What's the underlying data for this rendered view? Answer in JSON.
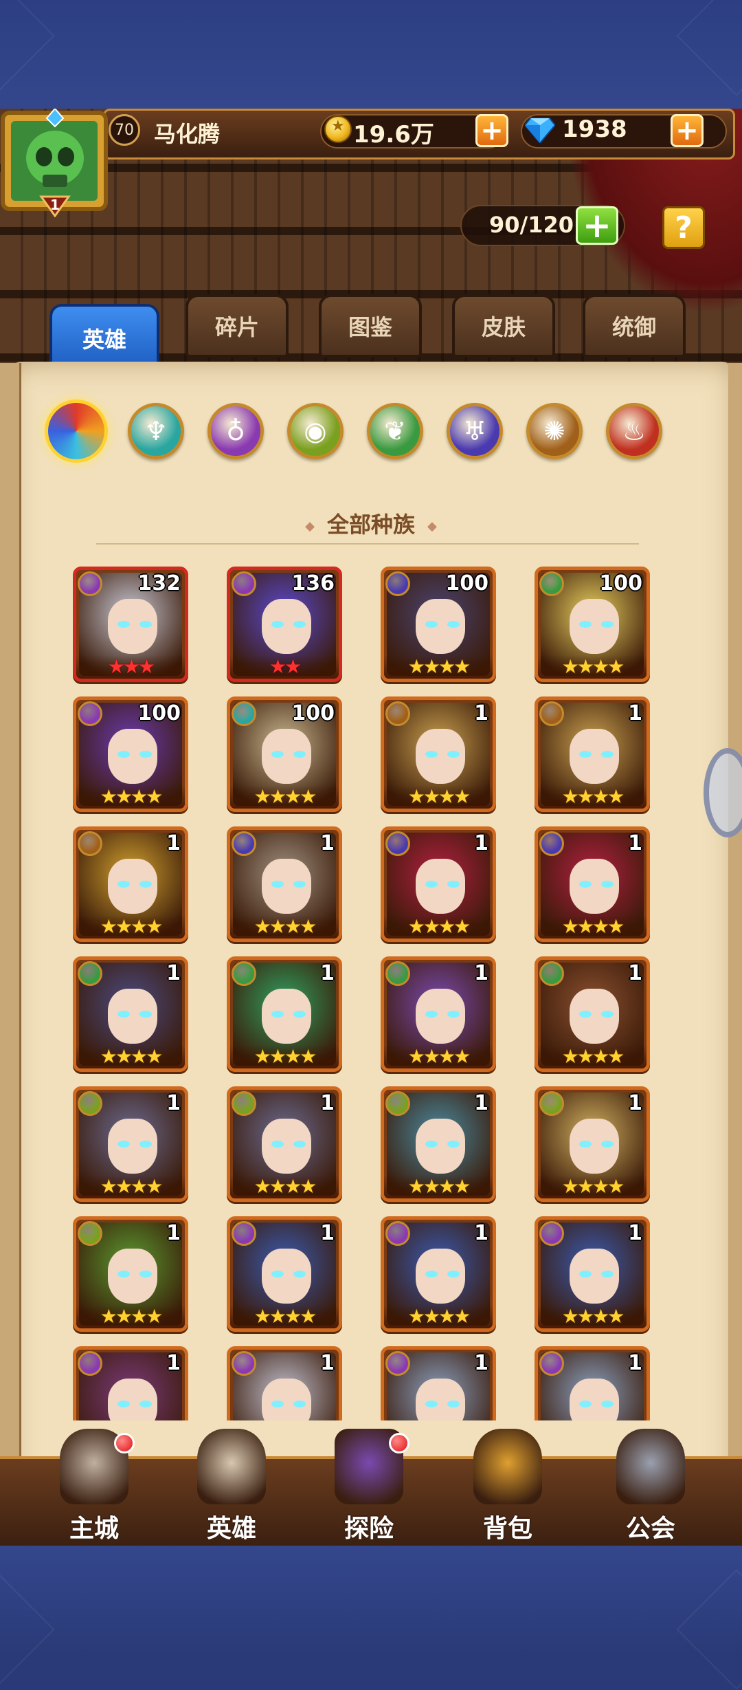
{
  "player": {
    "level": "70",
    "name": "马化腾",
    "avatar_rank": "1",
    "gold": "19.6万",
    "gems": "1938"
  },
  "hero_capacity": "90/120",
  "tabs": [
    {
      "label": "英雄",
      "active": true
    },
    {
      "label": "碎片",
      "active": false
    },
    {
      "label": "图鉴",
      "active": false
    },
    {
      "label": "皮肤",
      "active": false
    },
    {
      "label": "统御",
      "active": false
    }
  ],
  "race_filters": [
    {
      "name": "all-races",
      "icon": "rainbow-swirl-icon",
      "color": "#e8832a",
      "selected": true
    },
    {
      "name": "race-1",
      "icon": "teal-emblem-icon",
      "color": "#2aa6a0"
    },
    {
      "name": "race-2",
      "icon": "purple-emblem-icon",
      "color": "#8a3ab0"
    },
    {
      "name": "race-3",
      "icon": "green-eye-icon",
      "color": "#7aa020"
    },
    {
      "name": "race-4",
      "icon": "leaf-icon",
      "color": "#3a9a40"
    },
    {
      "name": "race-5",
      "icon": "demon-icon",
      "color": "#4a3ab0"
    },
    {
      "name": "race-6",
      "icon": "wheel-icon",
      "color": "#a0601a"
    },
    {
      "name": "race-7",
      "icon": "flame-icon",
      "color": "#c03020"
    }
  ],
  "filter_title": "全部种族",
  "heroes": [
    {
      "level": "132",
      "stars": "★★★",
      "star_color": "red",
      "frame": "red",
      "race_color": "#8a3ab0",
      "tone": "#c9c9d6"
    },
    {
      "level": "136",
      "stars": "★★",
      "star_color": "red",
      "frame": "red",
      "race_color": "#8a3ab0",
      "tone": "#5a4ad0"
    },
    {
      "level": "100",
      "stars": "★★★★",
      "star_color": "gold",
      "frame": "orange",
      "race_color": "#4a3ab0",
      "tone": "#4a4470"
    },
    {
      "level": "100",
      "stars": "★★★★",
      "star_color": "gold",
      "frame": "orange",
      "race_color": "#3a9a40",
      "tone": "#e8d060"
    },
    {
      "level": "100",
      "stars": "★★★★",
      "star_color": "gold",
      "frame": "orange",
      "race_color": "#8a3ab0",
      "tone": "#6a3ab0"
    },
    {
      "level": "100",
      "stars": "★★★★",
      "star_color": "gold",
      "frame": "orange",
      "race_color": "#2aa6a0",
      "tone": "#c8b890"
    },
    {
      "level": "1",
      "stars": "★★★★",
      "star_color": "gold",
      "frame": "orange",
      "race_color": "#a0601a",
      "tone": "#c8a050"
    },
    {
      "level": "1",
      "stars": "★★★★",
      "star_color": "gold",
      "frame": "orange",
      "race_color": "#a0601a",
      "tone": "#c8a050"
    },
    {
      "level": "1",
      "stars": "★★★★",
      "star_color": "gold",
      "frame": "orange",
      "race_color": "#a0601a",
      "tone": "#d0a030"
    },
    {
      "level": "1",
      "stars": "★★★★",
      "star_color": "gold",
      "frame": "orange",
      "race_color": "#4a3ab0",
      "tone": "#a09080"
    },
    {
      "level": "1",
      "stars": "★★★★",
      "star_color": "gold",
      "frame": "orange",
      "race_color": "#4a3ab0",
      "tone": "#b02040"
    },
    {
      "level": "1",
      "stars": "★★★★",
      "star_color": "gold",
      "frame": "orange",
      "race_color": "#4a3ab0",
      "tone": "#b02040"
    },
    {
      "level": "1",
      "stars": "★★★★",
      "star_color": "gold",
      "frame": "orange",
      "race_color": "#3a9a40",
      "tone": "#4a4a80"
    },
    {
      "level": "1",
      "stars": "★★★★",
      "star_color": "gold",
      "frame": "orange",
      "race_color": "#3a9a40",
      "tone": "#30a060"
    },
    {
      "level": "1",
      "stars": "★★★★",
      "star_color": "gold",
      "frame": "orange",
      "race_color": "#3a9a40",
      "tone": "#7a4ab0"
    },
    {
      "level": "1",
      "stars": "★★★★",
      "star_color": "gold",
      "frame": "orange",
      "race_color": "#3a9a40",
      "tone": "#8a5030"
    },
    {
      "level": "1",
      "stars": "★★★★",
      "star_color": "gold",
      "frame": "orange",
      "race_color": "#7aa020",
      "tone": "#6a6a90"
    },
    {
      "level": "1",
      "stars": "★★★★",
      "star_color": "gold",
      "frame": "orange",
      "race_color": "#7aa020",
      "tone": "#6a6a90"
    },
    {
      "level": "1",
      "stars": "★★★★",
      "star_color": "gold",
      "frame": "orange",
      "race_color": "#7aa020",
      "tone": "#4a8aa0"
    },
    {
      "level": "1",
      "stars": "★★★★",
      "star_color": "gold",
      "frame": "orange",
      "race_color": "#7aa020",
      "tone": "#d0b060"
    },
    {
      "level": "1",
      "stars": "★★★★",
      "star_color": "gold",
      "frame": "orange",
      "race_color": "#7aa020",
      "tone": "#5a9a30"
    },
    {
      "level": "1",
      "stars": "★★★★",
      "star_color": "gold",
      "frame": "orange",
      "race_color": "#8a3ab0",
      "tone": "#3a5ab0"
    },
    {
      "level": "1",
      "stars": "★★★★",
      "star_color": "gold",
      "frame": "orange",
      "race_color": "#8a3ab0",
      "tone": "#3a5ab0"
    },
    {
      "level": "1",
      "stars": "★★★★",
      "star_color": "gold",
      "frame": "orange",
      "race_color": "#8a3ab0",
      "tone": "#3a5ab0"
    },
    {
      "level": "1",
      "stars": "★★★★",
      "star_color": "gold",
      "frame": "orange",
      "race_color": "#8a3ab0",
      "tone": "#7a3a7a"
    },
    {
      "level": "1",
      "stars": "★★★★",
      "star_color": "gold",
      "frame": "orange",
      "race_color": "#8a3ab0",
      "tone": "#c0c0d0"
    },
    {
      "level": "1",
      "stars": "★★★★",
      "star_color": "gold",
      "frame": "orange",
      "race_color": "#8a3ab0",
      "tone": "#8aa0c0"
    },
    {
      "level": "1",
      "stars": "★★★★",
      "star_color": "gold",
      "frame": "orange",
      "race_color": "#8a3ab0",
      "tone": "#8aa0c0"
    }
  ],
  "nav": [
    {
      "label": "主城",
      "icon": "castle-icon",
      "badge": true
    },
    {
      "label": "英雄",
      "icon": "hero-portrait-icon",
      "badge": false
    },
    {
      "label": "探险",
      "icon": "portal-icon",
      "badge": true
    },
    {
      "label": "背包",
      "icon": "backpack-icon",
      "badge": false
    },
    {
      "label": "公会",
      "icon": "guild-tower-icon",
      "badge": false
    }
  ]
}
